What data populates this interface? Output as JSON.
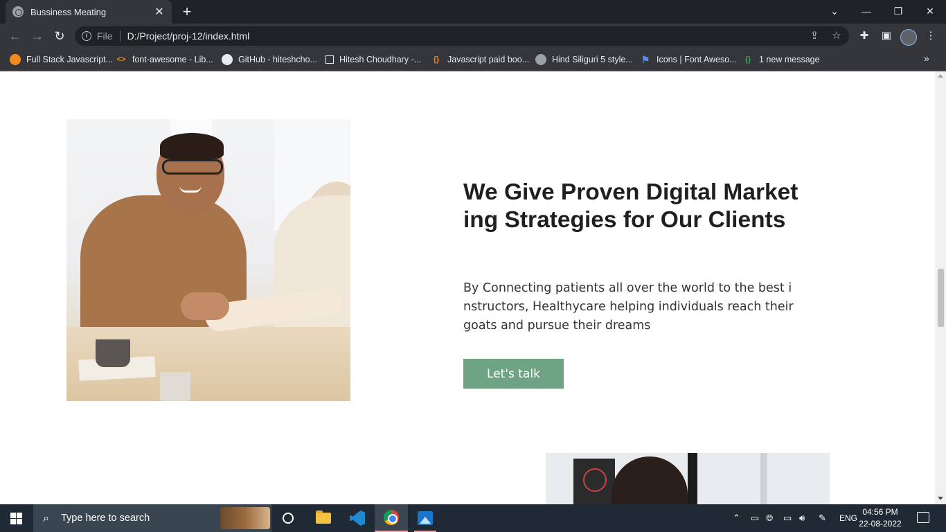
{
  "browser": {
    "tab_title": "Bussiness Meating",
    "address_scheme": "File",
    "address_url": "D:/Project/proj-12/index.html",
    "bookmarks": [
      {
        "label": "Full Stack Javascript...",
        "icon": "orange-circle-icon"
      },
      {
        "label": "font-awesome - Lib...",
        "icon": "code-brackets-icon"
      },
      {
        "label": "GitHub - hiteshcho...",
        "icon": "github-icon"
      },
      {
        "label": "Hitesh Choudhary -...",
        "icon": "square-icon"
      },
      {
        "label": "Javascript paid boo...",
        "icon": "braces-icon"
      },
      {
        "label": "Hind Siliguri 5 style...",
        "icon": "globe-icon"
      },
      {
        "label": "Icons | Font Aweso...",
        "icon": "flag-icon"
      },
      {
        "label": "1 new message",
        "icon": "message-icon"
      }
    ]
  },
  "page": {
    "heading": "We Give Proven Digital Marketing Strategies for Our Clients",
    "description": "By Connecting patients all over the world to the best instructors, Healthycare helping individuals reach their goats and pursue their dreams",
    "cta_label": "Let's talk",
    "accent_color": "#6ea384"
  },
  "taskbar": {
    "search_placeholder": "Type here to search",
    "language": "ENG",
    "time": "04:56 PM",
    "date": "22-08-2022"
  }
}
